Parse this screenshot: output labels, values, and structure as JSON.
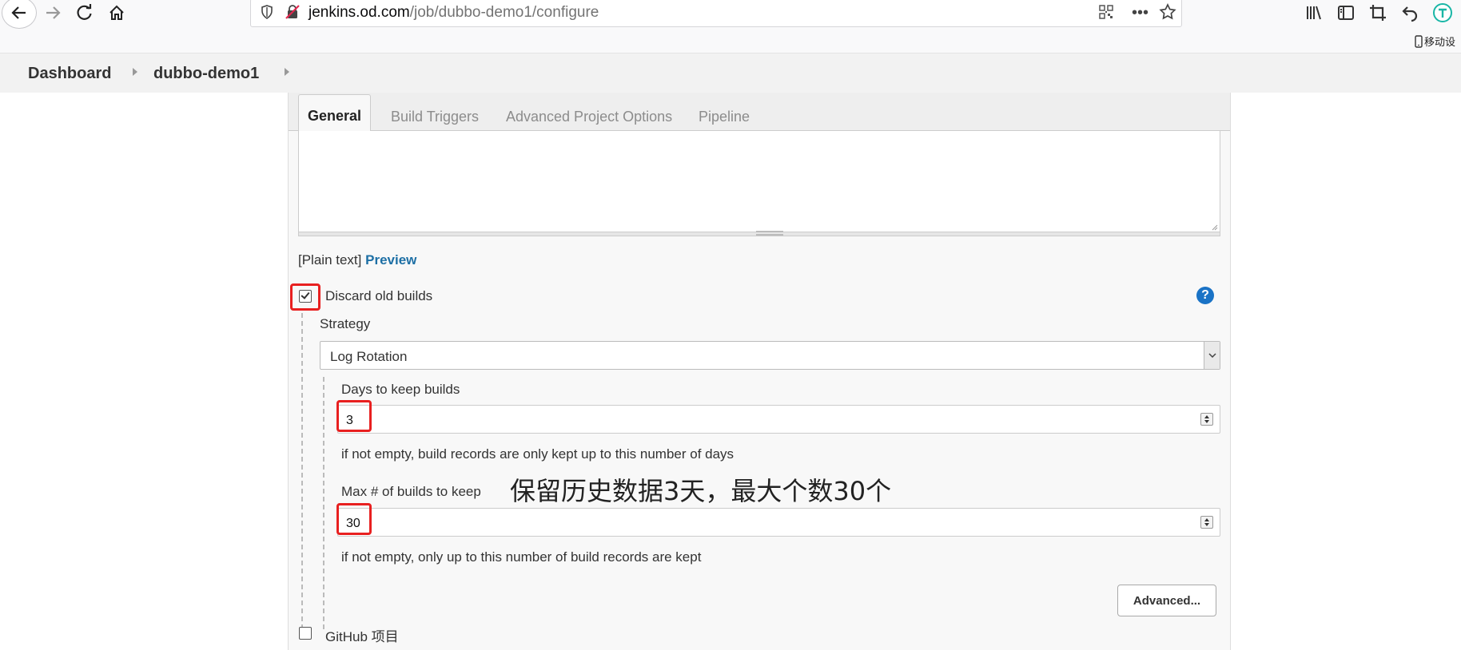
{
  "browser": {
    "url_host": "jenkins.od.com",
    "url_path": "/job/dubbo-demo1/configure",
    "mobile_label": "移动设"
  },
  "breadcrumb": {
    "items": [
      "Dashboard",
      "dubbo-demo1"
    ]
  },
  "tabs": [
    {
      "label": "General",
      "active": true
    },
    {
      "label": "Build Triggers",
      "active": false
    },
    {
      "label": "Advanced Project Options",
      "active": false
    },
    {
      "label": "Pipeline",
      "active": false
    }
  ],
  "description": {
    "plain_text_label": "[Plain text]",
    "preview_link": "Preview"
  },
  "discard_old_builds": {
    "label": "Discard old builds",
    "checked": true,
    "strategy_label": "Strategy",
    "strategy_value": "Log Rotation",
    "days_label": "Days to keep builds",
    "days_value": "3",
    "days_help": "if not empty, build records are only kept up to this number of days",
    "max_label": "Max # of builds to keep",
    "max_value": "30",
    "max_help": "if not empty, only up to this number of build records are kept",
    "advanced_button": "Advanced..."
  },
  "annotation": "保留历史数据3天，最大个数30个",
  "github_project": {
    "label": "GitHub 项目",
    "checked": false
  },
  "colors": {
    "highlight_red": "#e82020",
    "link_blue": "#1d6fa5",
    "help_blue": "#1a73c6"
  }
}
